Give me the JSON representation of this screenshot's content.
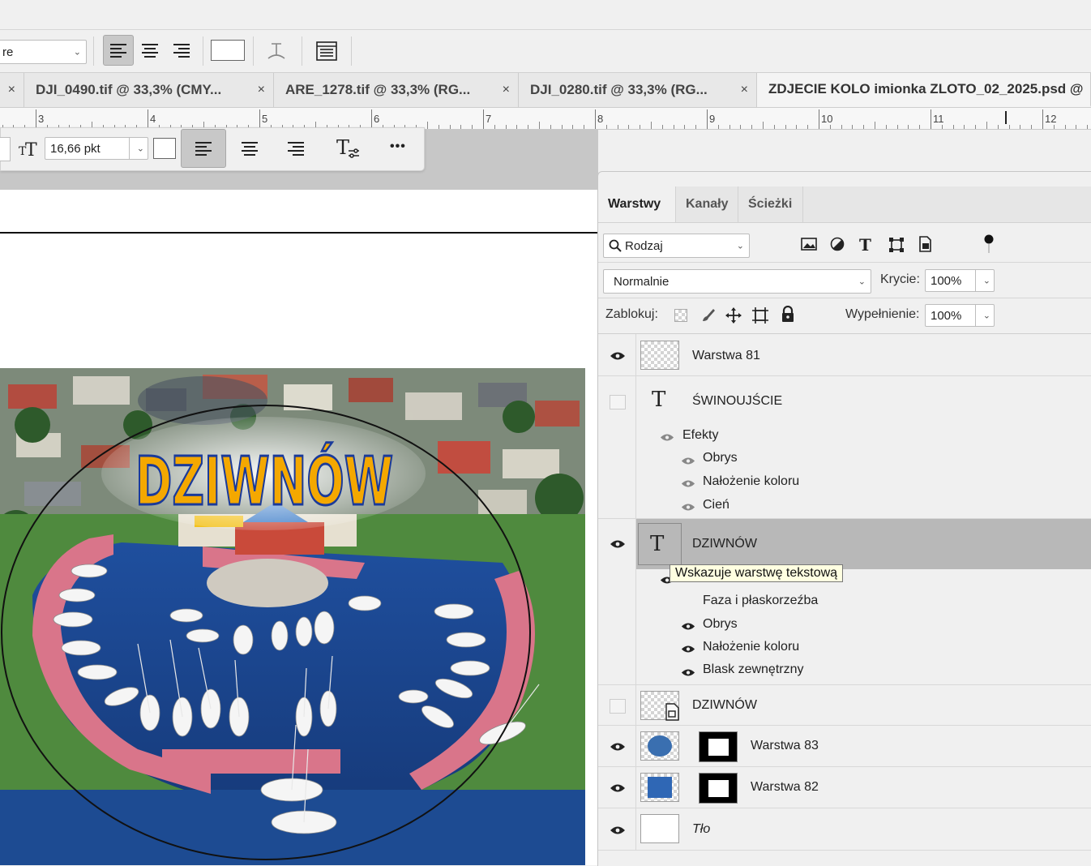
{
  "options_bar": {
    "font_style_value": "re",
    "align_left_icon": "align-left-icon",
    "align_center_icon": "align-center-icon",
    "align_right_icon": "align-right-icon"
  },
  "tabs": [
    {
      "label": "DJI_0490.tif @ 33,3% (CMY...",
      "close": "×"
    },
    {
      "label": "ARE_1278.tif @ 33,3% (RG...",
      "close": "×"
    },
    {
      "label": "DJI_0280.tif @ 33,3% (RG...",
      "close": "×"
    },
    {
      "label": "ZDJECIE KOLO imionka ZLOTO_02_2025.psd @",
      "close": ""
    }
  ],
  "ruler": {
    "numbers": [
      "3",
      "4",
      "5",
      "6",
      "7",
      "8",
      "9",
      "10",
      "11",
      "12"
    ]
  },
  "context_bar": {
    "font_size": "16,66 pkt",
    "more": "•••"
  },
  "photo": {
    "title_text": "DZIWNÓW"
  },
  "layers_panel": {
    "tabs": [
      "Warstwy",
      "Kanały",
      "Ścieżki"
    ],
    "filter_label": "Rodzaj",
    "blend_mode": "Normalnie",
    "opacity_label": "Krycie:",
    "opacity_value": "100%",
    "lock_label": "Zablokuj:",
    "fill_label": "Wypełnienie:",
    "fill_value": "100%",
    "layers": {
      "warstwa81": "Warstwa 81",
      "swinoujscie": "ŚWINOUJŚCIE",
      "swin_effects": "Efekty",
      "swin_fx1": "Obrys",
      "swin_fx2": "Nałożenie koloru",
      "swin_fx3": "Cień",
      "dziwnow_text": "DZIWNÓW",
      "dz_fx1": "Faza i płaskorzeźba",
      "dz_fx2": "Obrys",
      "dz_fx3": "Nałożenie koloru",
      "dz_fx4": "Blask zewnętrzny",
      "dziwnow_smart": "DZIWNÓW",
      "warstwa83": "Warstwa 83",
      "warstwa82": "Warstwa 82",
      "tlo": "Tło"
    },
    "tooltip": "Wskazuje warstwę tekstową"
  }
}
